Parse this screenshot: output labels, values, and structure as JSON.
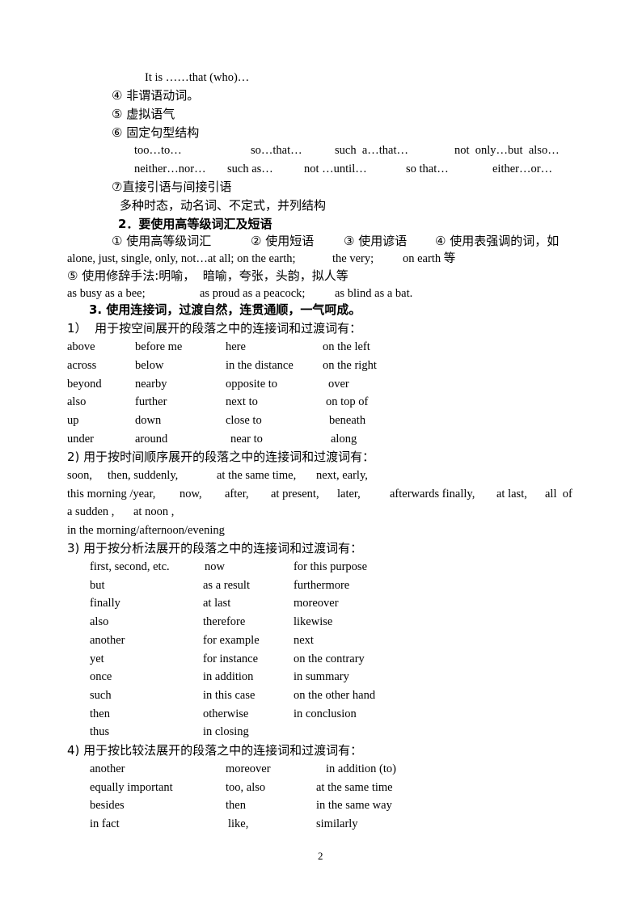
{
  "top": {
    "it_is_line": "It is ……that (who)…",
    "item4": "④ 非谓语动词。",
    "item5": "⑤ 虚拟语气",
    "item6": "⑥ 固定句型结构",
    "patterns_row1": [
      "too…to…",
      "so…that…",
      "such  a…that…",
      "not  only…but  also…"
    ],
    "patterns_row2": [
      "neither…nor…",
      "such as…",
      "not …until…",
      "so that…",
      "either…or…"
    ],
    "item7": "⑦直接引语与间接引语",
    "summary": "多种时态，动名词、不定式，并列结构"
  },
  "section2": {
    "heading": "2．要使用高等级词汇及短语",
    "items_line": [
      "① 使用高等级词汇",
      "② 使用短语",
      "③ 使用谚语",
      "④ 使用表强调的词，如"
    ],
    "emphasis_words": [
      "alone, just, single, only, not…at all; on the earth;",
      "the very;",
      "on earth 等"
    ],
    "rhetoric": "⑤ 使用修辞手法:明喻，  暗喻，夸张，头韵，拟人等",
    "similes": [
      "as busy as a bee;",
      "as proud as a peacock;",
      "as blind as a bat."
    ]
  },
  "section3": {
    "heading": "3. 使用连接词，过渡自然，连贯通顺，一气呵成。",
    "spatial": {
      "title": "1）  用于按空间展开的段落之中的连接词和过渡词有：",
      "rows": [
        [
          "above",
          "before me",
          "here",
          "on the left"
        ],
        [
          "across",
          "below",
          "in the distance",
          "on the right"
        ],
        [
          "beyond",
          "nearby",
          "opposite to",
          "over"
        ],
        [
          "also",
          "further",
          "next to",
          "on top of"
        ],
        [
          "up",
          "down",
          "close to",
          "beneath"
        ],
        [
          "under",
          "around",
          "near to",
          "along"
        ]
      ]
    },
    "temporal": {
      "title": "2) 用于按时间顺序展开的段落之中的连接词和过渡词有：",
      "line1": [
        "soon,",
        "then, suddenly,",
        "at the same time,",
        "next, early,"
      ],
      "line2": [
        "this morning /year,",
        "now,",
        "after,",
        "at present,",
        "later,",
        "afterwards finally,",
        "at last,",
        "all  of"
      ],
      "line3": [
        "a sudden ,",
        "at noon ,"
      ],
      "line4": "in the morning/afternoon/evening"
    },
    "analytic": {
      "title": "3) 用于按分析法展开的段落之中的连接词和过渡词有：",
      "rows": [
        [
          "first, second, etc.",
          "now",
          "for this purpose"
        ],
        [
          "but",
          "as a result",
          "furthermore"
        ],
        [
          "finally",
          "at last",
          "moreover"
        ],
        [
          "also",
          "therefore",
          "likewise"
        ],
        [
          "another",
          "for example",
          "next"
        ],
        [
          "yet",
          "for instance",
          "on the contrary"
        ],
        [
          "once",
          "in addition",
          "in summary"
        ],
        [
          "such",
          "in this case",
          "on the other hand"
        ],
        [
          "then",
          "otherwise",
          "in conclusion"
        ],
        [
          "thus",
          "in closing",
          ""
        ]
      ]
    },
    "comparative": {
      "title": "4) 用于按比较法展开的段落之中的连接词和过渡词有：",
      "rows": [
        [
          "another",
          "moreover",
          "in addition (to)"
        ],
        [
          "equally important",
          "too, also",
          "at the same time"
        ],
        [
          "besides",
          "then",
          "in the same way"
        ],
        [
          "in fact",
          "like,",
          "similarly"
        ]
      ]
    }
  },
  "footer": {
    "page_number": "2"
  }
}
